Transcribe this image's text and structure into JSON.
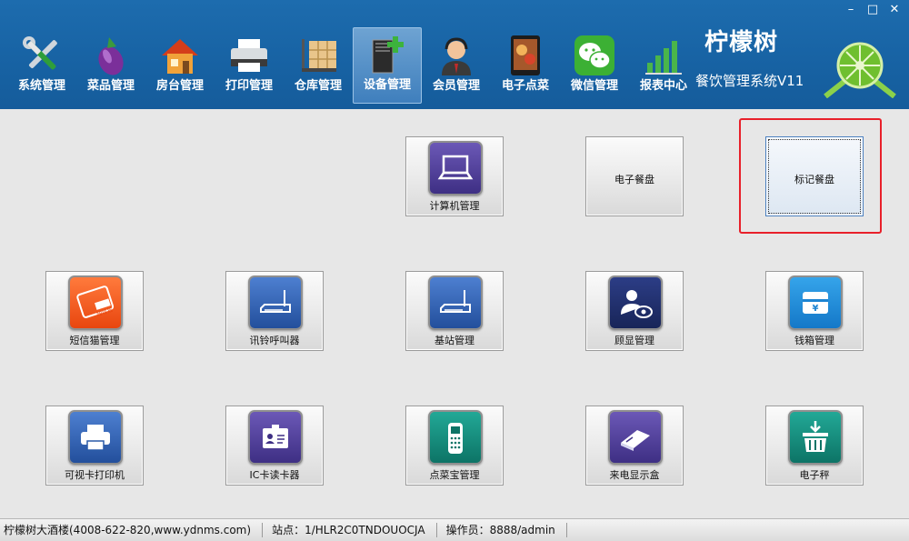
{
  "window": {
    "minimize": "–",
    "maximize": "□",
    "close": "✕"
  },
  "menu": [
    {
      "label": "系统管理",
      "icon": "tools-icon"
    },
    {
      "label": "菜品管理",
      "icon": "eggplant-icon"
    },
    {
      "label": "房台管理",
      "icon": "house-icon"
    },
    {
      "label": "打印管理",
      "icon": "printer-icon"
    },
    {
      "label": "仓库管理",
      "icon": "warehouse-icon"
    },
    {
      "label": "设备管理",
      "icon": "device-icon",
      "active": true
    },
    {
      "label": "会员管理",
      "icon": "member-icon"
    },
    {
      "label": "电子点菜",
      "icon": "tablet-menu-icon"
    },
    {
      "label": "微信管理",
      "icon": "wechat-icon"
    },
    {
      "label": "报表中心",
      "icon": "report-icon"
    }
  ],
  "brand": {
    "name": "柠檬树",
    "subtitle": "餐饮管理系统V11"
  },
  "tiles": {
    "computer": "计算机管理",
    "e_tray": "电子餐盘",
    "mark_tray": "标记餐盘",
    "sms_cat": "短信猫管理",
    "pager": "讯铃呼叫器",
    "base_station": "基站管理",
    "customer_display": "顾显管理",
    "cash_drawer": "钱箱管理",
    "card_printer": "可视卡打印机",
    "ic_reader": "IC卡读卡器",
    "order_device": "点菜宝管理",
    "caller_id": "来电显示盒",
    "scale": "电子秤"
  },
  "sms_badge": "短信猫",
  "colors": {
    "header": "#1a66a8",
    "highlight": "#e8202a",
    "purple": "#4b3a8e",
    "blue": "#2f62b0",
    "orange": "#f15a24",
    "navy": "#1f2f6e",
    "teal": "#0f8a7c"
  },
  "status": {
    "company": "柠檬树大酒楼(4008-622-820,www.ydnms.com)",
    "station": "站点：1/HLR2C0TNDOUOCJA",
    "operator": "操作员：8888/admin"
  }
}
